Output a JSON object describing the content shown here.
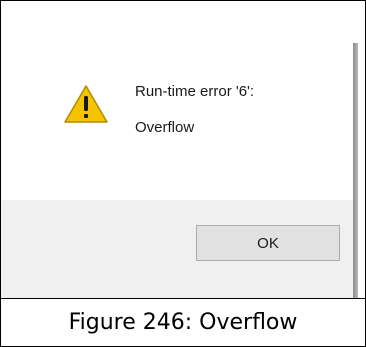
{
  "dialog": {
    "icon": "warning-icon",
    "message_title": "Run-time error '6':",
    "message_body": "Overflow",
    "ok_label": "OK"
  },
  "caption": {
    "text": "Figure 246: Overflow"
  },
  "colors": {
    "icon_fill": "#f5c400",
    "icon_outline": "#b58900",
    "button_bar": "#f0f0f0",
    "button_face": "#e1e1e1",
    "button_border": "#adadad"
  }
}
